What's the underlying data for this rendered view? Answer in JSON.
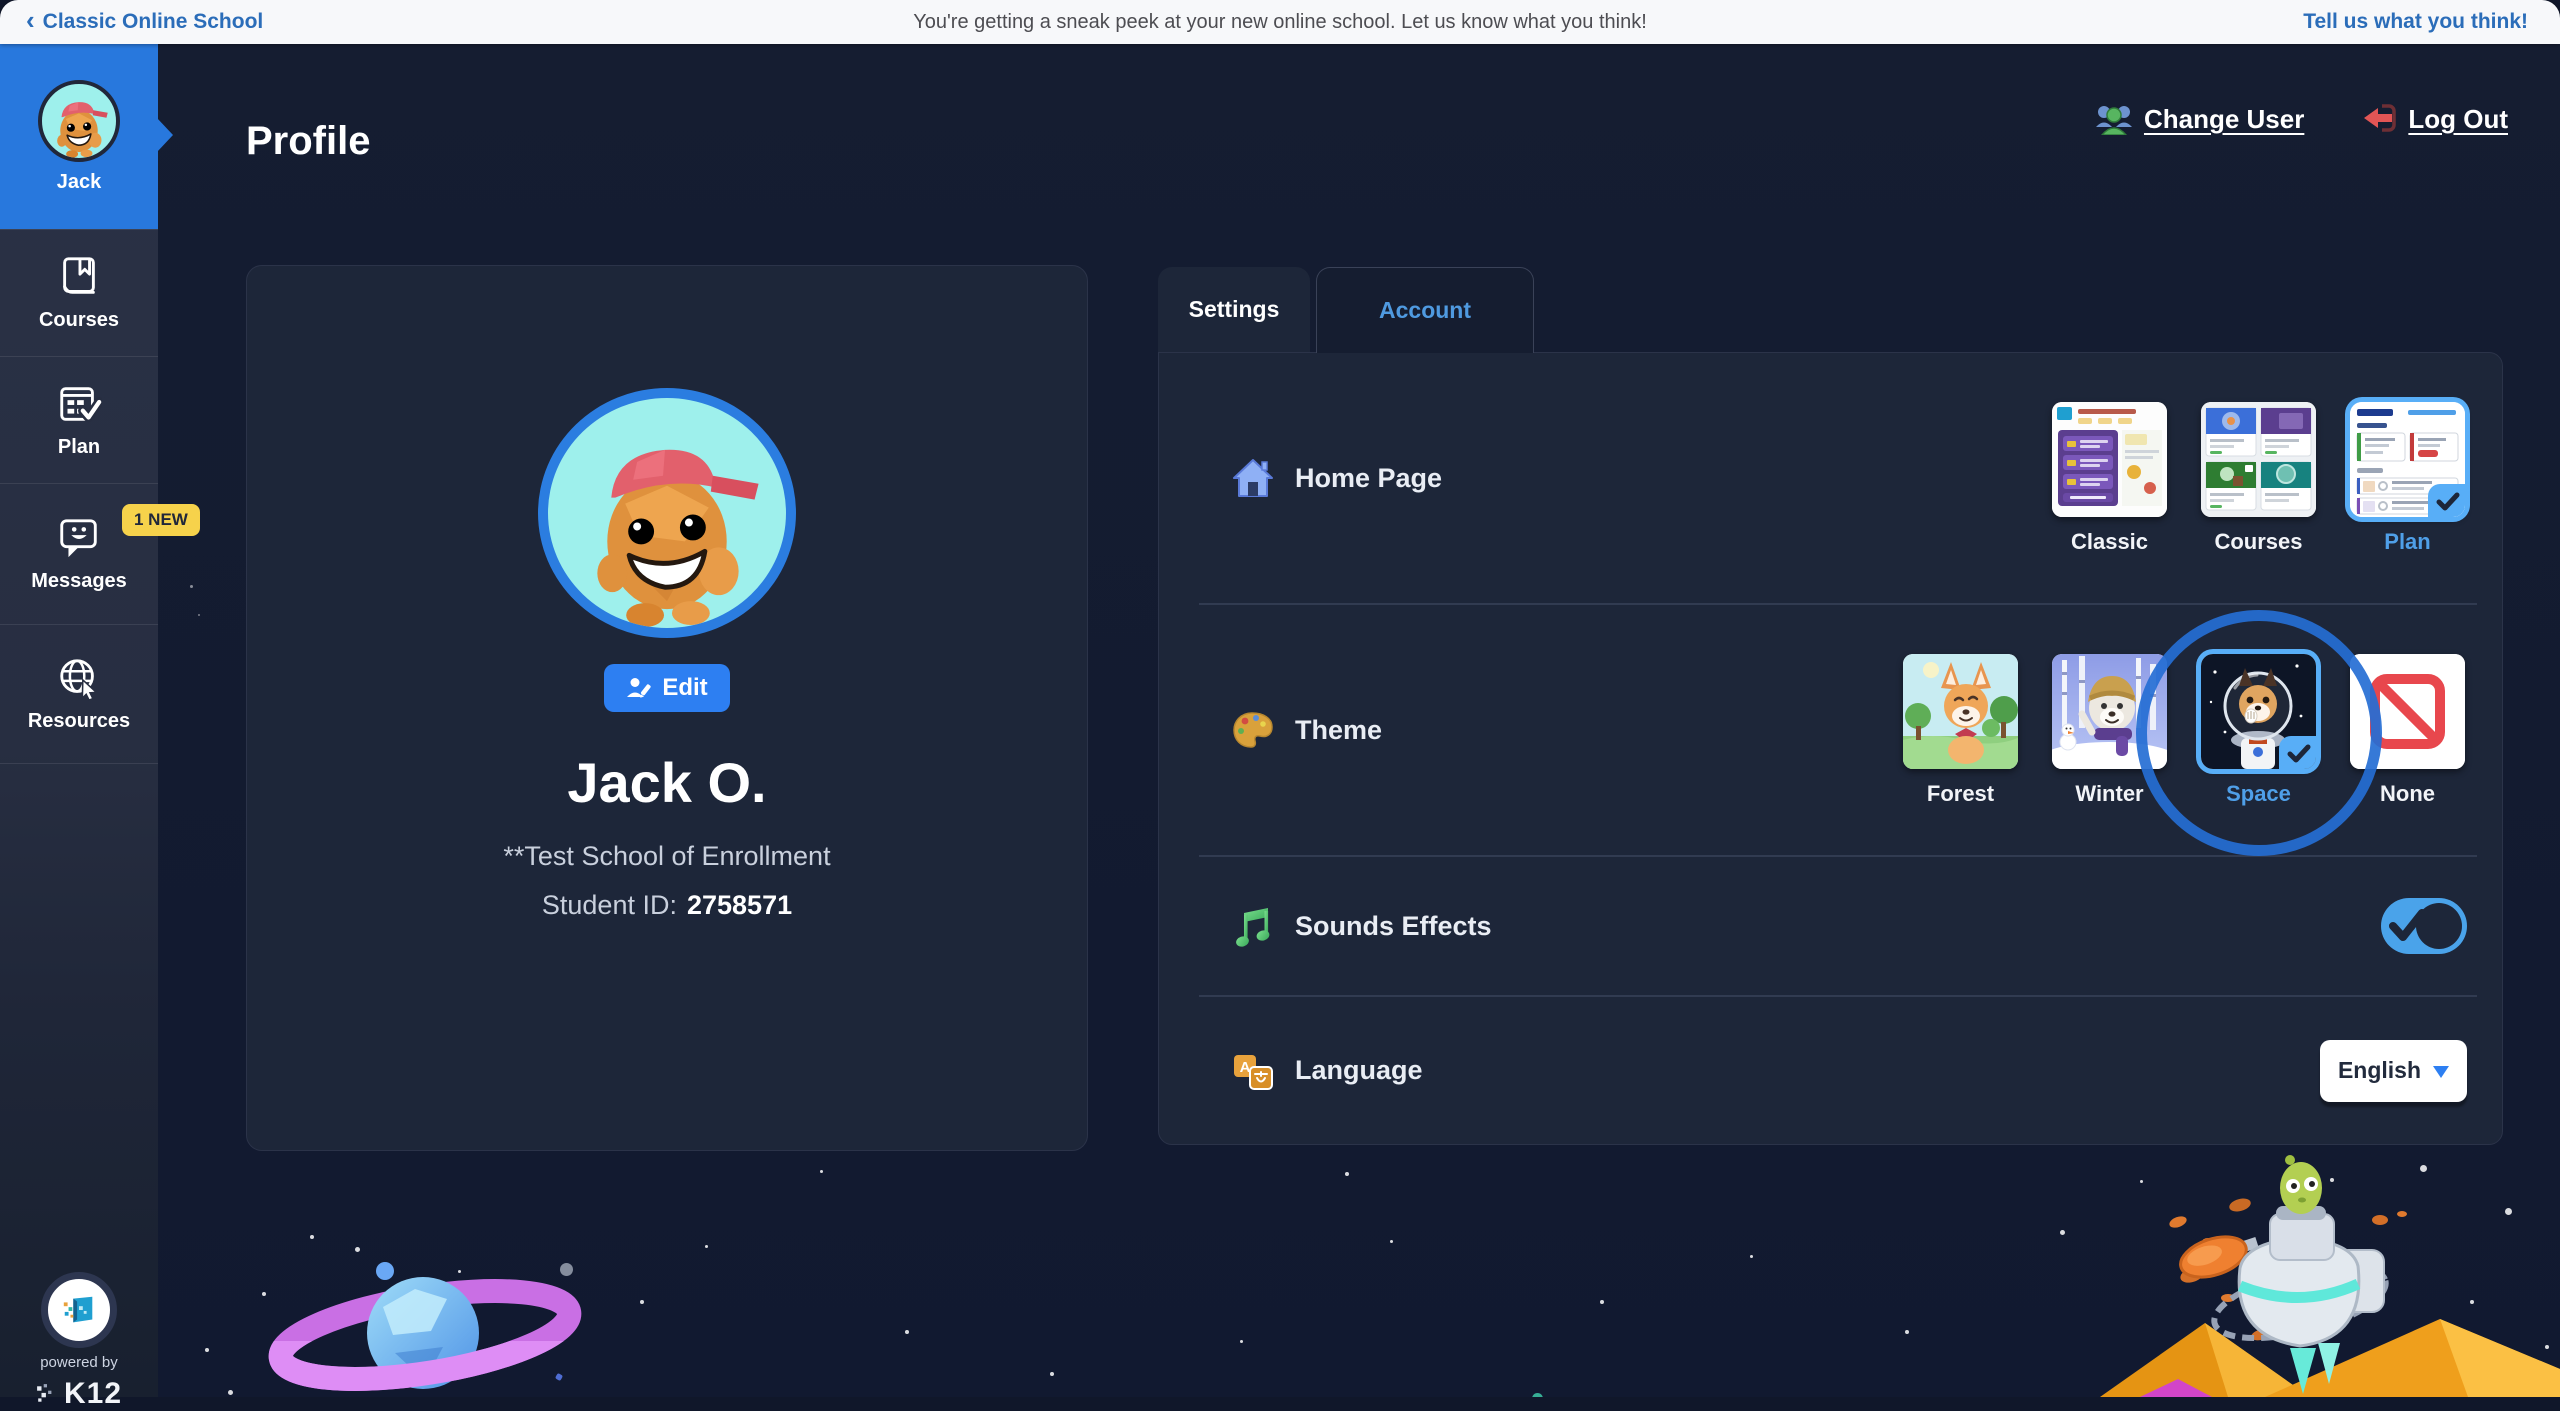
{
  "icons": {
    "back_chevron": "‹",
    "dropdown_arrow": "▼",
    "named": [
      "back-chevron-icon",
      "users-icon",
      "logout-icon",
      "avatar",
      "book-icon",
      "plan-icon",
      "messages-icon",
      "globe-icon",
      "home-icon",
      "palette-icon",
      "music-note-icon",
      "translate-icon",
      "edit-icon",
      "checkmark-icon",
      "dropdown-arrow-icon",
      "k12-logo"
    ]
  },
  "top_bar": {
    "back_link": "Classic Online School",
    "message": "You're getting a sneak peek at your new online school. Let us know what you think!",
    "feedback_link": "Tell us what you think!"
  },
  "sidebar": {
    "items": [
      {
        "label": "Jack",
        "active": true
      },
      {
        "label": "Courses"
      },
      {
        "label": "Plan"
      },
      {
        "label": "Messages",
        "badge": "1 NEW"
      },
      {
        "label": "Resources"
      }
    ],
    "powered_by": "powered by",
    "brand": "K12"
  },
  "header": {
    "title": "Profile",
    "change_user": "Change User",
    "log_out": "Log Out"
  },
  "profile_card": {
    "edit_label": "Edit",
    "name": "Jack O.",
    "school": "**Test School of Enrollment",
    "student_id_label": "Student ID:",
    "student_id": "2758571"
  },
  "tabs": [
    {
      "label": "Settings",
      "active": true
    },
    {
      "label": "Account",
      "active": false
    }
  ],
  "settings": {
    "home_page": {
      "label": "Home Page",
      "options": [
        {
          "label": "Classic",
          "selected": false
        },
        {
          "label": "Courses",
          "selected": false
        },
        {
          "label": "Plan",
          "selected": true
        }
      ]
    },
    "theme": {
      "label": "Theme",
      "options": [
        {
          "label": "Forest",
          "selected": false
        },
        {
          "label": "Winter",
          "selected": false
        },
        {
          "label": "Space",
          "selected": true
        },
        {
          "label": "None",
          "selected": false
        }
      ]
    },
    "sound_effects": {
      "label": "Sounds Effects",
      "enabled": true
    },
    "language": {
      "label": "Language",
      "value": "English"
    }
  },
  "colors": {
    "accent_blue": "#2d7ff2",
    "active_nav_blue": "#2878dd",
    "toggle_on_blue": "#4aa3ea",
    "selected_border_blue": "#58aef7",
    "badge_yellow": "#f6d24b",
    "logout_red": "#e25555",
    "link_blue": "#2b6db9",
    "panel_bg": "#1d2639",
    "main_bg": "#141c2f",
    "sidebar_bg": "#272e41"
  }
}
